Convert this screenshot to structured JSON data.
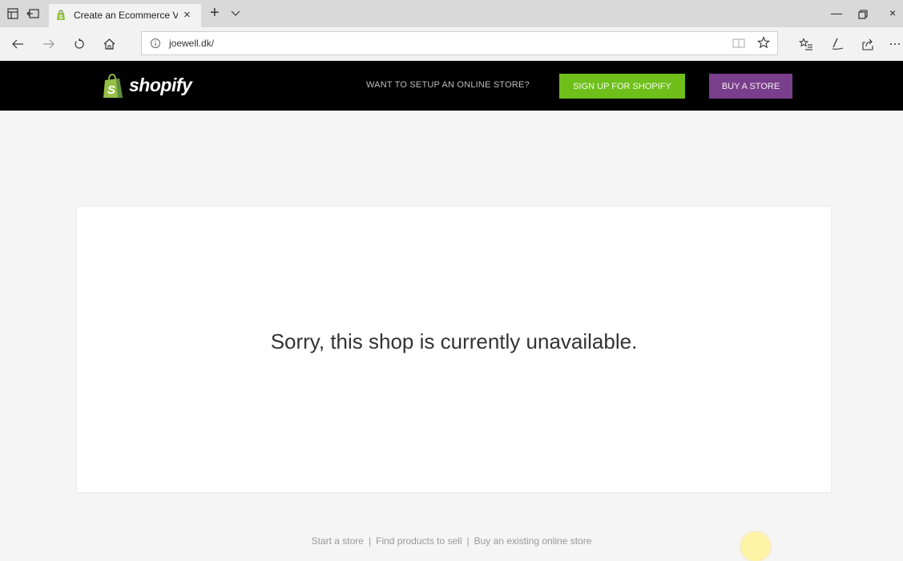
{
  "browser": {
    "tab": {
      "title": "Create an Ecommerce V",
      "close_glyph": "×"
    },
    "new_tab_glyph": "+",
    "window_controls": {
      "minimize": "—",
      "close": "×"
    },
    "address": {
      "url": "joewell.dk/"
    },
    "icons": [
      "tab-preview-icon",
      "set-aside-tabs-icon",
      "shopify-favicon",
      "chevron-down-icon",
      "back-icon",
      "forward-icon",
      "refresh-icon",
      "home-icon",
      "info-icon",
      "reading-view-icon",
      "star-icon",
      "favorites-hub-icon",
      "pen-icon",
      "share-icon",
      "more-icon",
      "restore-icon"
    ]
  },
  "header": {
    "logo_text": "shopify",
    "promo_text": "WANT TO SETUP AN ONLINE STORE?",
    "signup_label": "SIGN UP FOR SHOPIFY",
    "buy_label": "BUY A STORE",
    "colors": {
      "background": "#000000",
      "signup": "#6fbf1b",
      "buy": "#7a3f8c",
      "logo_bag": "#95bf47"
    }
  },
  "main": {
    "message": "Sorry, this shop is currently unavailable."
  },
  "footer": {
    "links": [
      "Start a store",
      "Find products to sell",
      "Buy an existing online store"
    ],
    "separator": "|"
  }
}
